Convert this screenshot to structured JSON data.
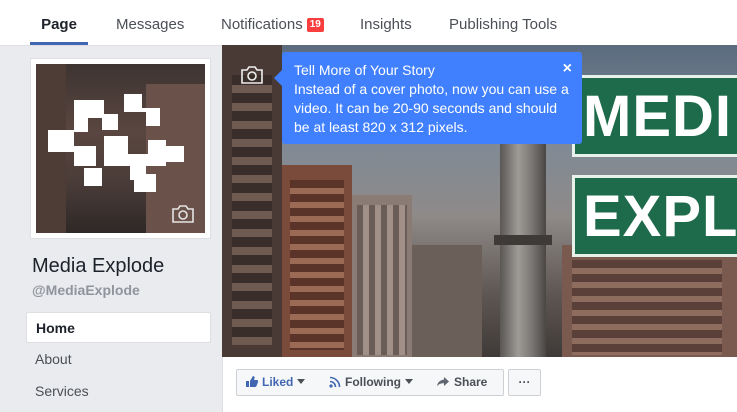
{
  "tabs": [
    {
      "label": "Page",
      "active": true
    },
    {
      "label": "Messages"
    },
    {
      "label": "Notifications",
      "badge": "19"
    },
    {
      "label": "Insights"
    },
    {
      "label": "Publishing Tools"
    }
  ],
  "page": {
    "name": "Media Explode",
    "handle": "@MediaExplode"
  },
  "nav": [
    {
      "label": "Home",
      "active": true
    },
    {
      "label": "About"
    },
    {
      "label": "Services"
    }
  ],
  "cover": {
    "sign_top": "MEDI",
    "sign_bottom": "EXPL"
  },
  "tooltip": {
    "title": "Tell More of Your Story",
    "body": "Instead of a cover photo, now you can use a video. It can be 20-90 seconds and should be at least 820 x 312 pixels.",
    "close": "×"
  },
  "actions": {
    "liked": "Liked",
    "following": "Following",
    "share": "Share",
    "more": "···"
  },
  "icons": {
    "camera": "camera-icon",
    "like": "thumbs-up-icon",
    "rss": "rss-icon",
    "share": "share-arrow-icon"
  },
  "colors": {
    "accent": "#4267b2",
    "tooltip": "#4080ff",
    "badge": "#fa3e3e",
    "sign_green": "#1d6b4a"
  }
}
